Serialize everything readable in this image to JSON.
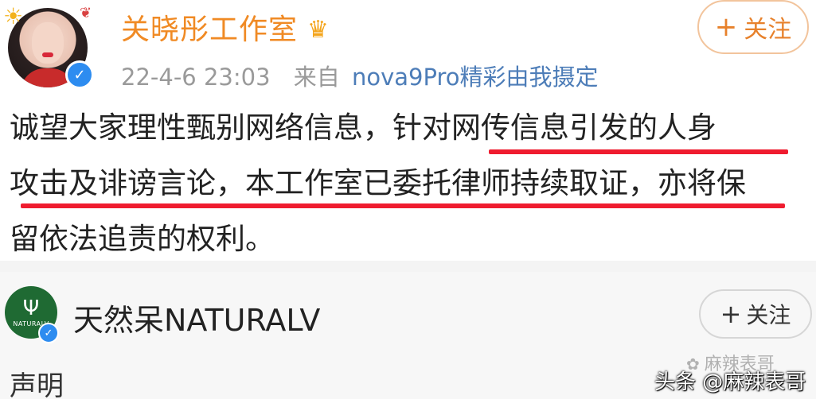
{
  "post": {
    "author_name": "关晓彤工作室",
    "timestamp": "22-4-6 23:03",
    "source_label": "来自",
    "source_device": "nova9Pro精彩由我摄定",
    "follow_label": "关注",
    "lines": [
      "诚望大家理性甄别网络信息，针对网传信息引发的人身",
      "攻击及诽谤言论，本工作室已委托律师持续取证，亦将保",
      "留依法追责的权利。"
    ]
  },
  "repost": {
    "author_name": "天然呆NATURALV",
    "avatar_text": "NATURALV",
    "follow_label": "关注",
    "body_text": "声明"
  },
  "watermarks": {
    "wechat": "麻辣表哥",
    "toutiao": "头条 @麻辣表哥"
  },
  "colors": {
    "accent_orange": "#f08a24",
    "link_blue": "#4d7db8",
    "underline_red": "#ef1c2f",
    "verified_blue": "#2d8cf0"
  }
}
